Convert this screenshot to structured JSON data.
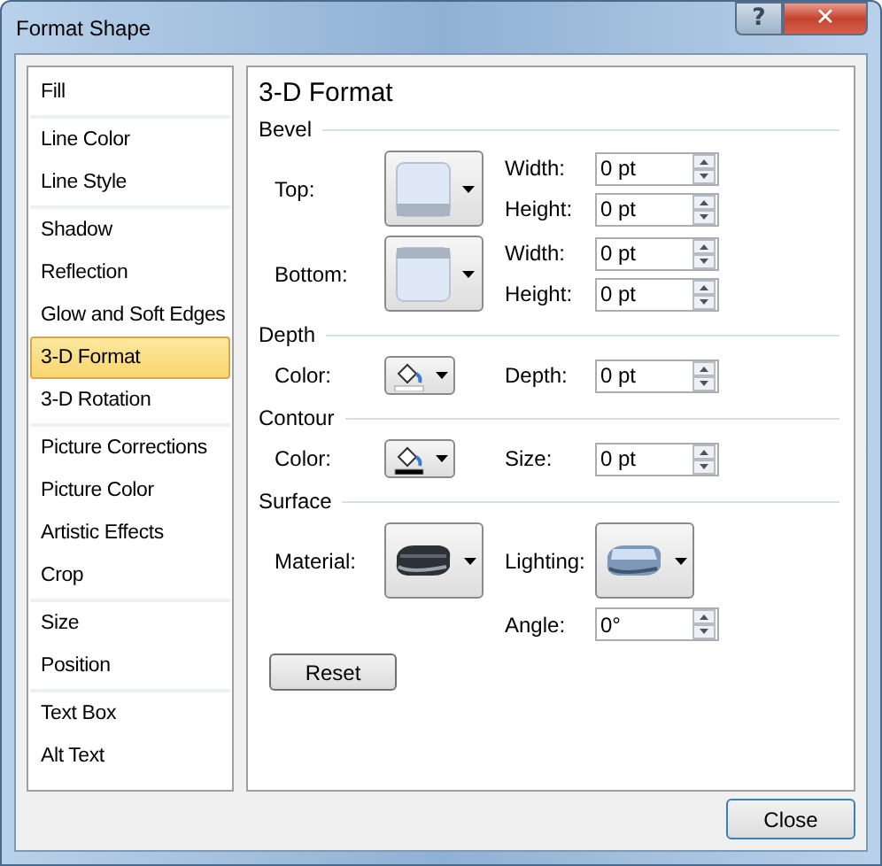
{
  "window": {
    "title": "Format Shape",
    "buttons": [
      "?",
      "✕"
    ]
  },
  "sidebar": {
    "groups": [
      {
        "items": [
          {
            "label": "Fill",
            "selected": false
          }
        ]
      },
      {
        "items": [
          {
            "label": "Line Color",
            "selected": false
          },
          {
            "label": "Line Style",
            "selected": false
          }
        ]
      },
      {
        "items": [
          {
            "label": "Shadow",
            "selected": false
          },
          {
            "label": "Reflection",
            "selected": false
          },
          {
            "label": "Glow and Soft Edges",
            "selected": false
          },
          {
            "label": "3-D Format",
            "selected": true
          },
          {
            "label": "3-D Rotation",
            "selected": false
          }
        ]
      },
      {
        "items": [
          {
            "label": "Picture Corrections",
            "selected": false
          },
          {
            "label": "Picture Color",
            "selected": false
          },
          {
            "label": "Artistic Effects",
            "selected": false
          },
          {
            "label": "Crop",
            "selected": false
          }
        ]
      },
      {
        "items": [
          {
            "label": "Size",
            "selected": false
          },
          {
            "label": "Position",
            "selected": false
          }
        ]
      },
      {
        "items": [
          {
            "label": "Text Box",
            "selected": false
          },
          {
            "label": "Alt Text",
            "selected": false
          }
        ]
      }
    ]
  },
  "panel": {
    "title": "3-D Format",
    "sections": [
      {
        "label": "Bevel",
        "rows": [
          {
            "label": "Top:",
            "kind": "bevel-top",
            "fields": [
              {
                "label": "Width:",
                "value": "0 pt"
              },
              {
                "label": "Height:",
                "value": "0 pt"
              }
            ]
          },
          {
            "label": "Bottom:",
            "kind": "bevel-bottom",
            "fields": [
              {
                "label": "Width:",
                "value": "0 pt"
              },
              {
                "label": "Height:",
                "value": "0 pt"
              }
            ]
          }
        ]
      },
      {
        "label": "Depth",
        "rows": [
          {
            "label": "Color:",
            "kind": "fill-color",
            "fields": [
              {
                "label": "Depth:",
                "value": "0 pt"
              }
            ]
          }
        ]
      },
      {
        "label": "Contour",
        "rows": [
          {
            "label": "Color:",
            "kind": "line-color",
            "fields": [
              {
                "label": "Size:",
                "value": "0 pt"
              }
            ]
          }
        ]
      },
      {
        "label": "Surface",
        "rows": [
          {
            "label": "Material:",
            "kind": "material",
            "side": {
              "label": "Lighting:",
              "kind": "lighting"
            }
          },
          {
            "fields": [
              {
                "label": "Angle:",
                "value": "0°"
              }
            ]
          }
        ]
      }
    ],
    "reset": "Reset"
  },
  "buttons": [
    "Close"
  ]
}
